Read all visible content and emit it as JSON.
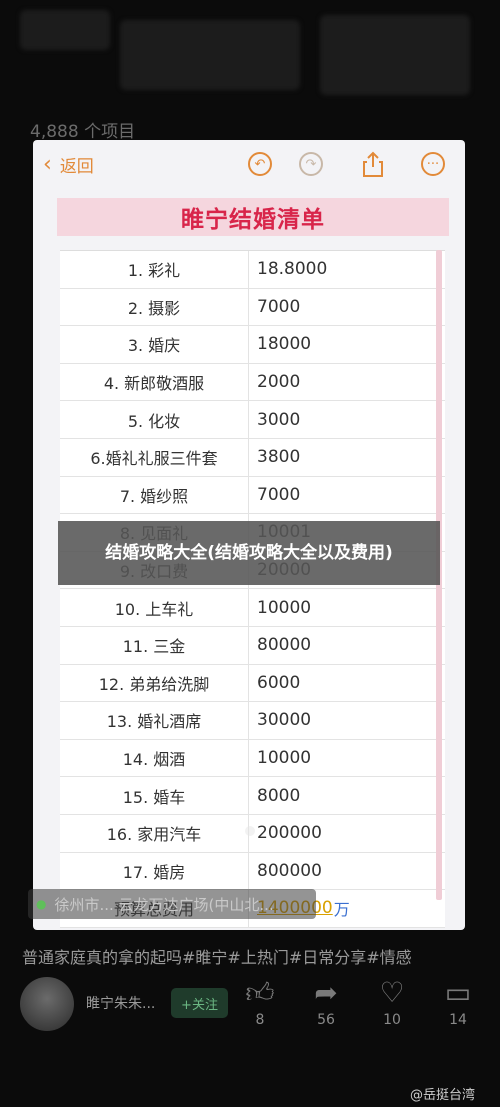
{
  "background": {
    "item_count": "4,888 个项目"
  },
  "topbar": {
    "back_label": "返回",
    "back_icon": "chevron-left-icon",
    "undo_icon": "undo-icon",
    "redo_icon": "redo-icon",
    "share_icon": "share-icon",
    "more_icon": "more-icon"
  },
  "doc": {
    "title": "睢宁结婚清单",
    "rows": [
      {
        "item": "1. 彩礼",
        "amount": "18.8000"
      },
      {
        "item": "2. 摄影",
        "amount": "7000"
      },
      {
        "item": "3. 婚庆",
        "amount": "18000"
      },
      {
        "item": "4. 新郎敬酒服",
        "amount": "2000"
      },
      {
        "item": "5. 化妆",
        "amount": "3000"
      },
      {
        "item": "6.婚礼礼服三件套",
        "amount": "3800"
      },
      {
        "item": "7. 婚纱照",
        "amount": "7000"
      },
      {
        "item": "8. 见面礼",
        "amount": "10001"
      },
      {
        "item": "9. 改口费",
        "amount": "20000"
      },
      {
        "item": "10. 上车礼",
        "amount": "10000"
      },
      {
        "item": "11. 三金",
        "amount": "80000"
      },
      {
        "item": "12. 弟弟给洗脚",
        "amount": "6000"
      },
      {
        "item": "13. 婚礼酒席",
        "amount": "30000"
      },
      {
        "item": "14. 烟酒",
        "amount": "10000"
      },
      {
        "item": "15. 婚车",
        "amount": "8000"
      },
      {
        "item": "16. 家用汽车",
        "amount": "200000"
      },
      {
        "item": "17. 婚房",
        "amount": "800000"
      }
    ],
    "total_label": "预算总费用",
    "total_amount": "1400000",
    "total_unit": "万"
  },
  "overlay": {
    "title": "结婚攻略大全(结婚攻略大全以及费用)"
  },
  "post": {
    "location": "徐州市... 云龙万达广场(中山北...",
    "caption": "普通家庭真的拿的起吗#睢宁#上热门#日常分享#情感",
    "username": "睢宁朱朱...",
    "follow_label": "+关注",
    "likes": "8",
    "shares": "56",
    "comments_like": "10",
    "comments": "14"
  },
  "watermark": "@岳挺台湾"
}
